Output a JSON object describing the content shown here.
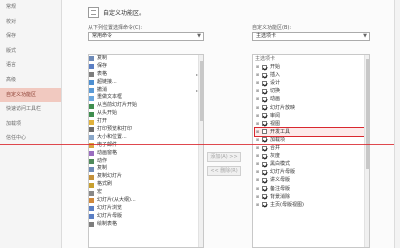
{
  "sidebar": {
    "items": [
      {
        "label": "常规",
        "active": false
      },
      {
        "label": "校对",
        "active": false
      },
      {
        "label": "保存",
        "active": false
      },
      {
        "label": "版式",
        "active": false
      },
      {
        "label": "语言",
        "active": false
      },
      {
        "label": "高级",
        "active": false
      },
      {
        "label": "自定义功能区",
        "active": true
      },
      {
        "label": "快速访问工具栏",
        "active": false
      },
      {
        "label": "加载项",
        "active": false
      },
      {
        "label": "信任中心",
        "active": false
      }
    ]
  },
  "header": {
    "title": "自定义功能区。"
  },
  "left_panel": {
    "label": "从下列位置选择命令(C):",
    "dropdown_value": "常用命令",
    "items": [
      {
        "label": "复制",
        "icon_color": "#6d8ab8",
        "submenu": false
      },
      {
        "label": "保存",
        "icon_color": "#5b7fc4",
        "submenu": false
      },
      {
        "label": "表格",
        "icon_color": "#7d7d7d",
        "submenu": true
      },
      {
        "label": "超链接...",
        "icon_color": "#4d8fd1",
        "submenu": false
      },
      {
        "label": "撤消",
        "icon_color": "#5a9ad6",
        "submenu": true
      },
      {
        "label": "重做文本框",
        "icon_color": "#6aa7df",
        "submenu": false
      },
      {
        "label": "从当前幻灯片开始",
        "icon_color": "#3f8e4f",
        "submenu": false
      },
      {
        "label": "从头开始",
        "icon_color": "#3f8e4f",
        "submenu": false
      },
      {
        "label": "打开",
        "icon_color": "#e1b23b",
        "submenu": false
      },
      {
        "label": "打印预览和打印",
        "icon_color": "#6b6b6b",
        "submenu": false
      },
      {
        "label": "大小和位置...",
        "icon_color": "#8aa7c9",
        "submenu": false
      },
      {
        "label": "电子邮件",
        "icon_color": "#d9a441",
        "submenu": false
      },
      {
        "label": "动画窗格",
        "icon_color": "#9a6dc0",
        "submenu": false
      },
      {
        "label": "动作",
        "icon_color": "#4f8a5a",
        "submenu": false
      },
      {
        "label": "复制",
        "icon_color": "#6d8ab8",
        "submenu": false
      },
      {
        "label": "复制幻灯片",
        "icon_color": "#c4913a",
        "submenu": false
      },
      {
        "label": "格式刷",
        "icon_color": "#c8a030",
        "submenu": false
      },
      {
        "label": "宏",
        "icon_color": "#888888",
        "submenu": false
      },
      {
        "label": "幻灯片(从大纲)...",
        "icon_color": "#d0893b",
        "submenu": false
      },
      {
        "label": "幻灯片浏览",
        "icon_color": "#5b7fc4",
        "submenu": false
      },
      {
        "label": "幻灯片母版",
        "icon_color": "#5b7fc4",
        "submenu": false
      },
      {
        "label": "绘制表格",
        "icon_color": "#7d7d7d",
        "submenu": false
      }
    ]
  },
  "middle": {
    "add_label": "添加(A) >>",
    "remove_label": "<< 删除(R)"
  },
  "right_panel": {
    "label": "自定义功能区(B):",
    "dropdown_value": "主选项卡",
    "section_header": "主选项卡",
    "items": [
      {
        "label": "开始",
        "checked": true,
        "highlight": false
      },
      {
        "label": "插入",
        "checked": true,
        "highlight": false
      },
      {
        "label": "设计",
        "checked": true,
        "highlight": false
      },
      {
        "label": "切换",
        "checked": true,
        "highlight": false
      },
      {
        "label": "动画",
        "checked": true,
        "highlight": false
      },
      {
        "label": "幻灯片放映",
        "checked": true,
        "highlight": false
      },
      {
        "label": "审阅",
        "checked": true,
        "highlight": false
      },
      {
        "label": "视图",
        "checked": true,
        "highlight": false
      },
      {
        "label": "开发工具",
        "checked": false,
        "highlight": true
      },
      {
        "label": "加载项",
        "checked": true,
        "highlight": false
      },
      {
        "label": "合并",
        "checked": true,
        "highlight": false
      },
      {
        "label": "灰度",
        "checked": true,
        "highlight": false
      },
      {
        "label": "黑白模式",
        "checked": true,
        "highlight": false
      },
      {
        "label": "幻灯片母版",
        "checked": true,
        "highlight": false
      },
      {
        "label": "讲义母版",
        "checked": true,
        "highlight": false
      },
      {
        "label": "备注母版",
        "checked": true,
        "highlight": false
      },
      {
        "label": "背景消除",
        "checked": true,
        "highlight": false
      },
      {
        "label": "主页(母版视图)",
        "checked": true,
        "highlight": false
      }
    ]
  },
  "colors": {
    "accent": "#d9282f",
    "selected_nav": "#f1c9c0"
  }
}
